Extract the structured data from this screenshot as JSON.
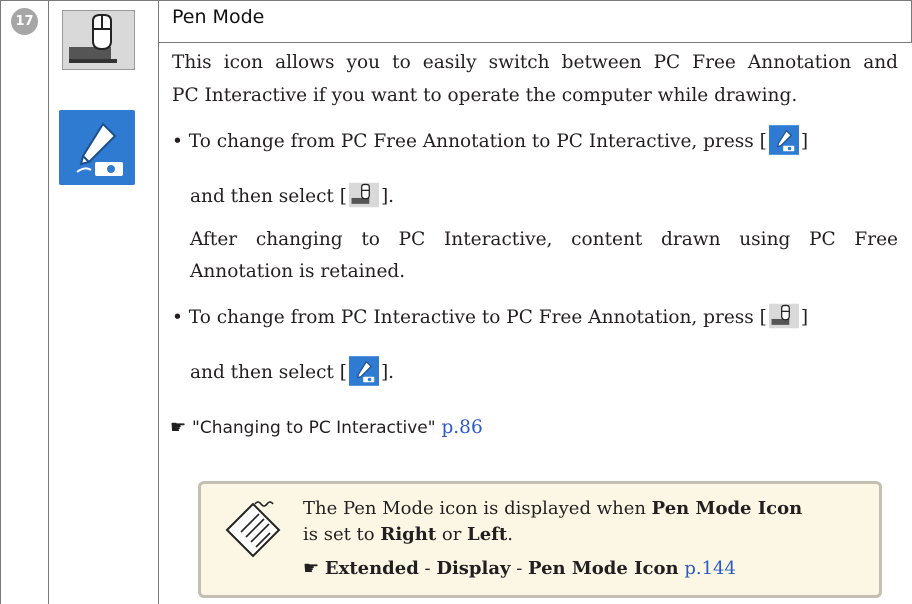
{
  "row": {
    "number": "17",
    "title": "Pen Mode"
  },
  "body": {
    "intro_line1": "This icon allows you to easily switch between PC Free Annotation and",
    "intro_line2": "PC Interactive if you want to operate the computer while drawing.",
    "bullet1_line1": "To change from PC Free Annotation to PC Interactive, press [",
    "bullet1_line1_end": "]",
    "bullet1_line2_start": "and then select [",
    "bullet1_line2_end": "].",
    "bullet1_note_line1": "After changing to PC Interactive, content drawn using PC Free",
    "bullet1_note_line2": "Annotation is retained.",
    "bullet2_line1": "To change from PC Interactive to PC Free Annotation, press [",
    "bullet2_line1_end": "]",
    "bullet2_line2_start": "and then select [",
    "bullet2_line2_end": "].",
    "ref_text": "\"Changing to PC Interactive\"",
    "ref_page": "p.86"
  },
  "note": {
    "text_part1": "The Pen Mode icon is displayed when ",
    "bold1": "Pen Mode Icon",
    "text_part2": " is set to ",
    "bold2": "Right",
    "text_part3": " or ",
    "bold3": "Left",
    "text_part4": ".",
    "ref_bold1": "Extended",
    "ref_sep1": " - ",
    "ref_bold2": "Display",
    "ref_sep2": " - ",
    "ref_bold3": "Pen Mode Icon",
    "ref_page": "p.144"
  },
  "icons": {
    "row_number": "circled-number-17-icon",
    "pc_interactive": "mouse-on-computer-icon",
    "pc_free_annotation": "pen-on-projector-icon",
    "reference": "pointing-hand-icon",
    "note": "memo-notepad-icon"
  },
  "colors": {
    "link": "#2c58c8",
    "pen_icon_bg": "#2f7bd1",
    "note_bg": "#fbf7e4",
    "badge": "#a6a6a6"
  }
}
